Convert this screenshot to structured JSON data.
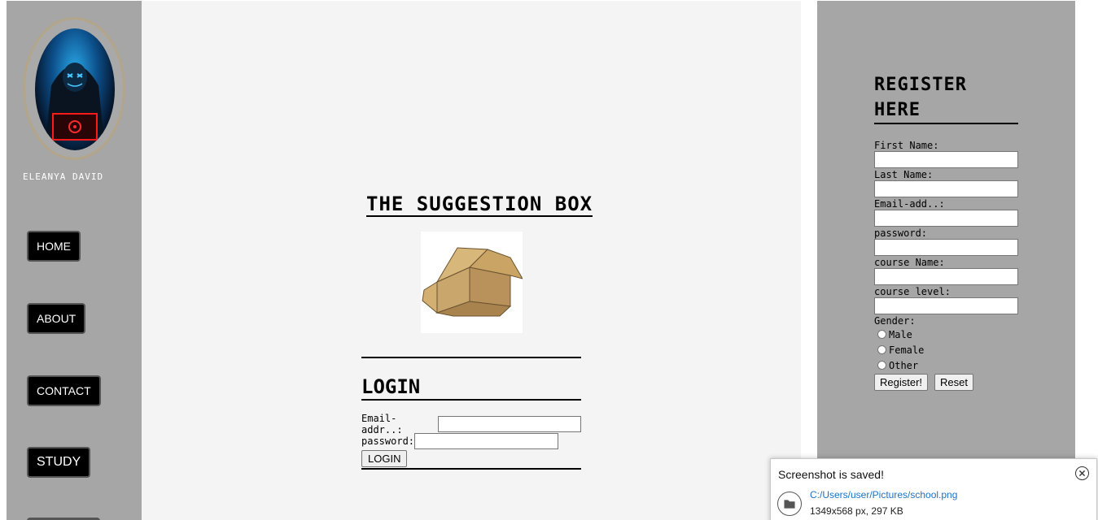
{
  "sidebar": {
    "user_name": "ELEANYA DAVID",
    "nav": {
      "home": "HOME",
      "about": "ABOUT",
      "contact": "CONTACT",
      "study": "STUDY"
    }
  },
  "main": {
    "title": "THE SUGGESTION BOX",
    "login": {
      "title": "LOGIN",
      "email_label": "Email-addr..:",
      "password_label": "password:",
      "button": "LOGIN"
    }
  },
  "register": {
    "title_line1": "REGISTER",
    "title_line2": "HERE",
    "first_name": "First Name:",
    "last_name": "Last Name:",
    "email": "Email-add..:",
    "password": "password:",
    "course_name": "course Name:",
    "course_level": "course level:",
    "gender": "Gender:",
    "gender_options": [
      "Male",
      "Female",
      "Other"
    ],
    "register_button": "Register!",
    "reset_button": "Reset"
  },
  "notification": {
    "title": "Screenshot is saved!",
    "path": "C:/Users/user/Pictures/school.png",
    "meta": "1349x568 px, 297 KB"
  }
}
